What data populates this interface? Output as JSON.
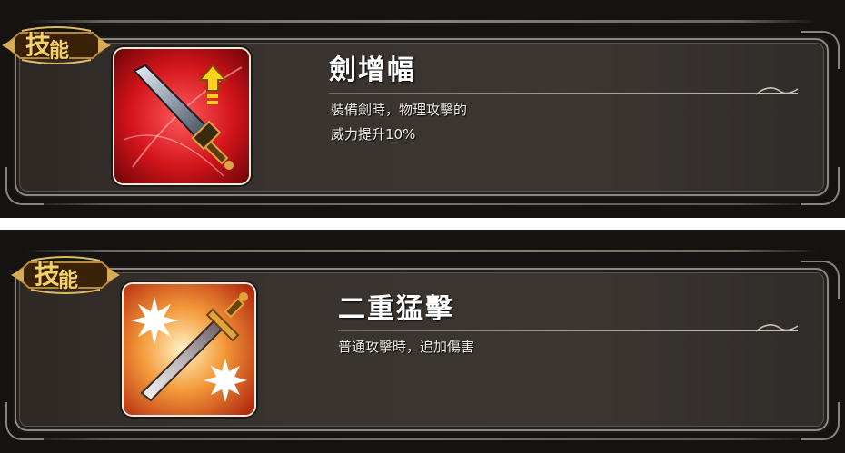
{
  "skills": [
    {
      "badge_label": "技能",
      "badge_char1": "技",
      "badge_char2": "能",
      "name": "劍增幅",
      "description": "裝備劍時，物理攻擊的\n威力提升10%",
      "icon": "sword-boost-icon",
      "accent": "#d2141b"
    },
    {
      "badge_label": "技能",
      "badge_char1": "技",
      "badge_char2": "能",
      "name": "二重猛擊",
      "description": "普通攻擊時，追加傷害",
      "icon": "double-strike-icon",
      "accent": "#f07a1e"
    }
  ]
}
